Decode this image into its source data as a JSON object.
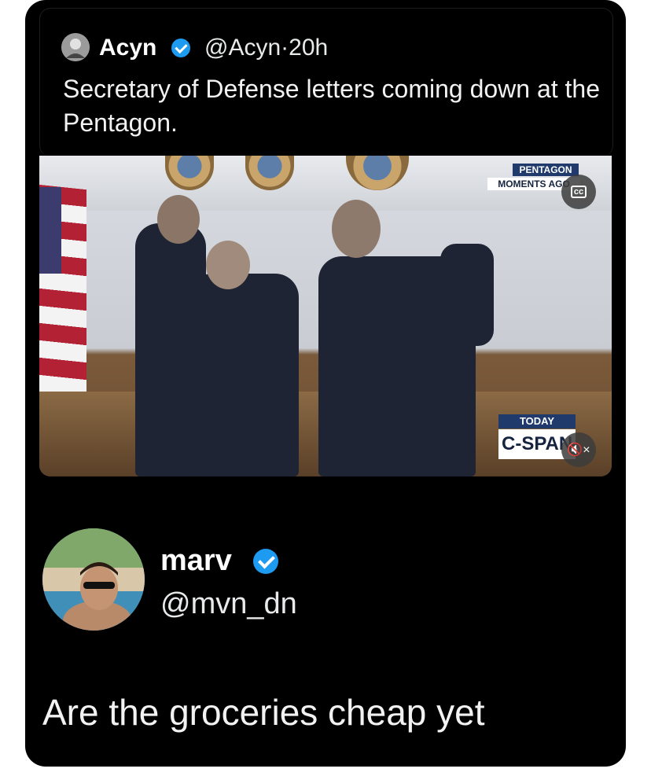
{
  "quoted": {
    "name": "Acyn",
    "handle_time": "@Acyn·20h",
    "text": "Secretary of Defense letters coming down at the Pentagon."
  },
  "video": {
    "top_chip_1": "PENTAGON",
    "top_chip_2": "MOMENTS AGO",
    "cc_label": "cc",
    "bottom_chip_1": "TODAY",
    "bottom_chip_2": "C-SPAN",
    "mute_label": "🔇×"
  },
  "reply": {
    "name": "marv",
    "handle": "@mvn_dn",
    "text": "Are the groceries cheap yet"
  },
  "colors": {
    "background": "#000000",
    "verified": "#1d9bf0",
    "text": "#f2f2f2"
  }
}
